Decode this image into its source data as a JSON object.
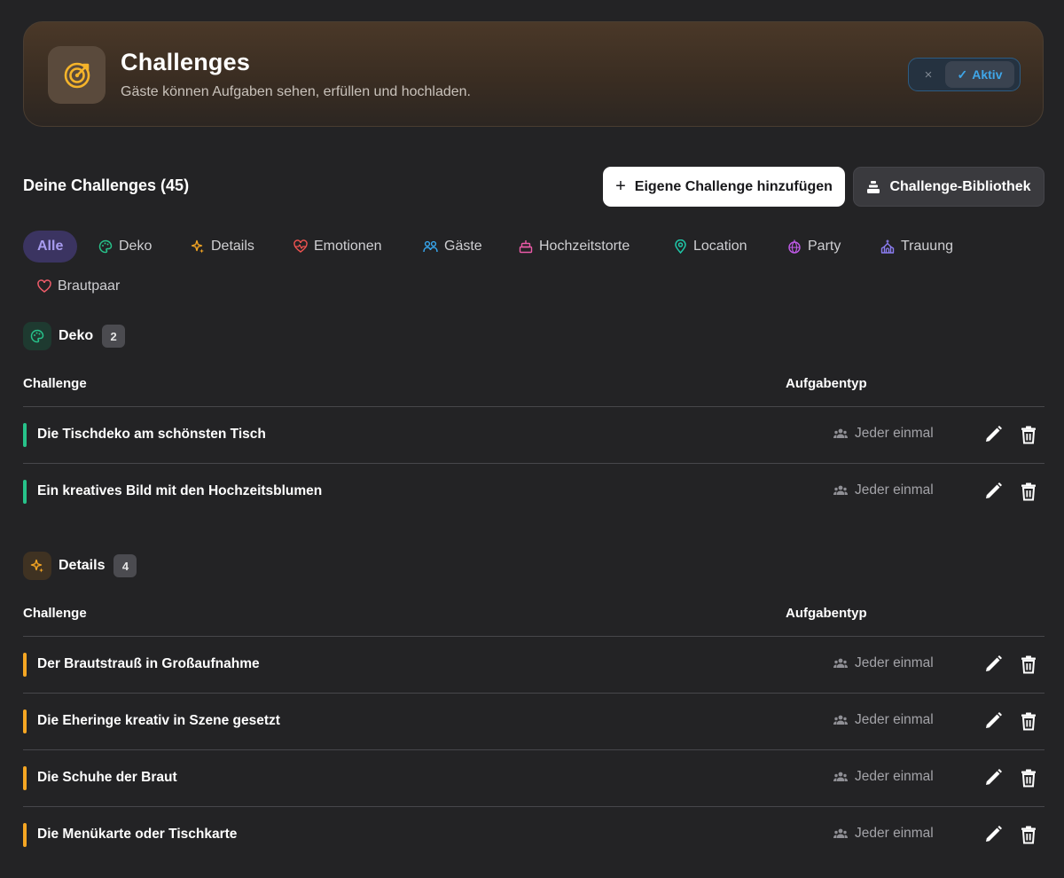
{
  "header": {
    "title": "Challenges",
    "subtitle": "Gäste können Aufgaben sehen, erfüllen und hochladen.",
    "icon": "target-icon",
    "toggle": {
      "off_symbol": "×",
      "on_symbol": "✓",
      "on_label": "Aktiv",
      "state": "on"
    }
  },
  "challenges": {
    "heading": "Deine Challenges (45)",
    "add_button": {
      "symbol": "+",
      "label": "Eigene Challenge hinzufügen"
    },
    "library_button": {
      "icon": "library-stack-icon",
      "label": "Challenge-Bibliothek"
    }
  },
  "filters": [
    {
      "label": "Alle",
      "icon": "",
      "active": true
    },
    {
      "label": "Deko",
      "icon": "palette-icon",
      "color": "#27c28a"
    },
    {
      "label": "Details",
      "icon": "sparkles-icon",
      "color": "#f5a623"
    },
    {
      "label": "Emotionen",
      "icon": "heart-pulse-icon",
      "color": "#ef5350"
    },
    {
      "label": "Gäste",
      "icon": "users-icon",
      "color": "#38a8f0"
    },
    {
      "label": "Hochzeitstorte",
      "icon": "cake-icon",
      "color": "#ec5aa8"
    },
    {
      "label": "Location",
      "icon": "map-pin-icon",
      "color": "#1fc7a8"
    },
    {
      "label": "Party",
      "icon": "disco-ball-icon",
      "color": "#c05ae8"
    },
    {
      "label": "Trauung",
      "icon": "church-icon",
      "color": "#8a7cf0"
    },
    {
      "label": "Brautpaar",
      "icon": "heart-icon",
      "color": "#ef5c6a"
    }
  ],
  "columns": {
    "challenge": "Challenge",
    "type": "Aufgabentyp"
  },
  "sections": [
    {
      "title": "Deko",
      "count": "2",
      "icon": "palette-icon",
      "color": "#27c28a",
      "rows": [
        {
          "title": "Die Tischdeko am schönsten Tisch",
          "type": "Jeder einmal"
        },
        {
          "title": "Ein kreatives Bild mit den Hochzeitsblumen",
          "type": "Jeder einmal"
        }
      ]
    },
    {
      "title": "Details",
      "count": "4",
      "icon": "sparkles-icon",
      "color": "#f5a623",
      "rows": [
        {
          "title": "Der Brautstrauß in Großaufnahme",
          "type": "Jeder einmal"
        },
        {
          "title": "Die Eheringe kreativ in Szene gesetzt",
          "type": "Jeder einmal"
        },
        {
          "title": "Die Schuhe der Braut",
          "type": "Jeder einmal"
        },
        {
          "title": "Die Menükarte oder Tischkarte",
          "type": "Jeder einmal"
        }
      ]
    }
  ]
}
